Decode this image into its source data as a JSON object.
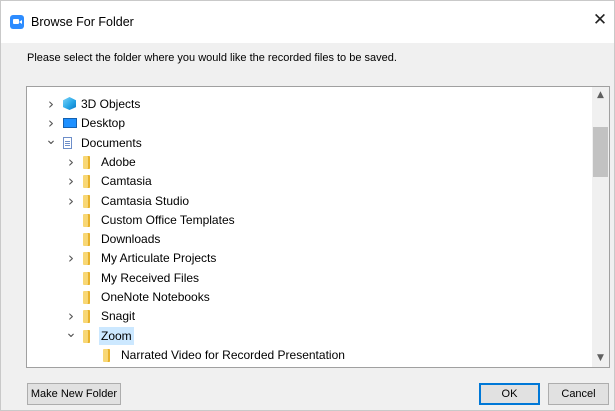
{
  "window": {
    "title": "Browse For Folder",
    "close_glyph": "✕"
  },
  "instruction": "Please select the folder where you would like the recorded files to be saved.",
  "tree": {
    "items": [
      {
        "label": "3D Objects",
        "icon": "3d-objects-icon",
        "expander": "collapsed",
        "level": 1
      },
      {
        "label": "Desktop",
        "icon": "desktop-icon",
        "expander": "collapsed",
        "level": 1
      },
      {
        "label": "Documents",
        "icon": "documents-icon",
        "expander": "expanded",
        "level": 1
      },
      {
        "label": "Adobe",
        "icon": "folder-icon",
        "expander": "collapsed",
        "level": 2
      },
      {
        "label": "Camtasia",
        "icon": "folder-icon",
        "expander": "collapsed",
        "level": 2
      },
      {
        "label": "Camtasia Studio",
        "icon": "folder-icon",
        "expander": "collapsed",
        "level": 2
      },
      {
        "label": "Custom Office Templates",
        "icon": "folder-icon",
        "expander": "none",
        "level": 2
      },
      {
        "label": "Downloads",
        "icon": "folder-icon",
        "expander": "none",
        "level": 2
      },
      {
        "label": "My Articulate Projects",
        "icon": "folder-icon",
        "expander": "collapsed",
        "level": 2
      },
      {
        "label": "My Received Files",
        "icon": "folder-icon",
        "expander": "none",
        "level": 2
      },
      {
        "label": "OneNote Notebooks",
        "icon": "folder-icon",
        "expander": "none",
        "level": 2
      },
      {
        "label": "Snagit",
        "icon": "folder-icon",
        "expander": "collapsed",
        "level": 2
      },
      {
        "label": "Zoom",
        "icon": "folder-icon",
        "expander": "expanded",
        "level": 2,
        "selected": true
      },
      {
        "label": "Narrated Video for Recorded Presentation",
        "icon": "folder-icon",
        "expander": "none",
        "level": 3
      }
    ]
  },
  "buttons": {
    "make_new_folder": "Make New Folder",
    "ok": "OK",
    "cancel": "Cancel"
  },
  "colors": {
    "selection": "#cce8ff",
    "accent": "#0078d7",
    "folder": "#f8d775"
  }
}
